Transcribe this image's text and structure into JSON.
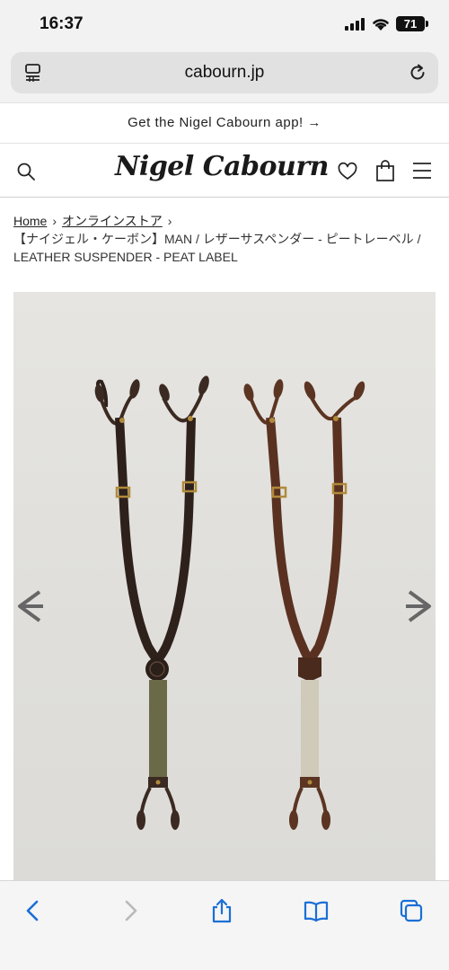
{
  "status_bar": {
    "time": "16:37",
    "battery": "71"
  },
  "browser": {
    "url": "cabourn.jp"
  },
  "app_banner": {
    "text": "Get the Nigel Cabourn app! →"
  },
  "header": {
    "logo": "Nigel Cabourn"
  },
  "breadcrumb": {
    "home": "Home",
    "online_store": "オンラインストア",
    "separator": "›",
    "current": "【ナイジェル・ケーボン】MAN / レザーサスペンダー - ピートレーベル / LEATHER SUSPENDER - PEAT LABEL"
  },
  "icons": {
    "reader": "reader-mode-icon",
    "reload": "reload-icon",
    "search": "search-icon",
    "wishlist": "heart-icon",
    "cart": "shopping-bag-icon",
    "menu": "hamburger-menu-icon",
    "prev": "arrow-left-icon",
    "next": "arrow-right-icon",
    "back": "chevron-left-icon",
    "forward": "chevron-right-icon",
    "share": "share-icon",
    "bookmarks": "book-icon",
    "tabs": "tabs-icon"
  },
  "colors": {
    "accent": "#1a6fd6",
    "leather_dark": "#3b2a22",
    "leather_brown": "#5b3422",
    "webbing_olive": "#6b6a48",
    "webbing_natural": "#cfcab9",
    "brass": "#b08a3a"
  }
}
